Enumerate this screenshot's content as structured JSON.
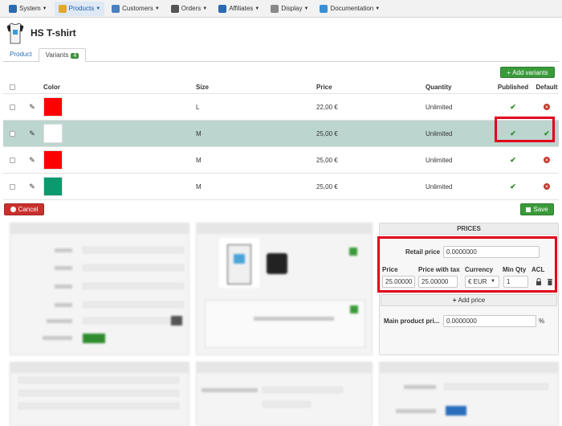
{
  "nav": {
    "items": [
      {
        "label": "System",
        "icon": "wrench-icon",
        "color": "#2b6cb0"
      },
      {
        "label": "Products",
        "icon": "box-icon",
        "color": "#e0a82e",
        "active": true
      },
      {
        "label": "Customers",
        "icon": "users-icon",
        "color": "#4a7fc1"
      },
      {
        "label": "Orders",
        "icon": "cart-icon",
        "color": "#555555"
      },
      {
        "label": "Affiliates",
        "icon": "affiliate-icon",
        "color": "#2b6cb0"
      },
      {
        "label": "Display",
        "icon": "display-icon",
        "color": "#888888"
      },
      {
        "label": "Documentation",
        "icon": "globe-icon",
        "color": "#3a8fd6"
      }
    ]
  },
  "product": {
    "title": "HS T-shirt"
  },
  "tabs": {
    "product": "Product",
    "variants": "Variants",
    "variants_count": "4"
  },
  "buttons": {
    "add_variants": "Add variants",
    "cancel": "Cancel",
    "save": "Save",
    "add_price": "Add price"
  },
  "table": {
    "headers": {
      "color": "Color",
      "size": "Size",
      "price": "Price",
      "quantity": "Quantity",
      "published": "Published",
      "default": "Default"
    },
    "rows": [
      {
        "color": "#ff0000",
        "size": "L",
        "price": "22,00 €",
        "quantity": "Unlimited",
        "published": true,
        "default": false
      },
      {
        "color": "#ffffff",
        "size": "M",
        "price": "25,00 €",
        "quantity": "Unlimited",
        "published": true,
        "default": true
      },
      {
        "color": "#ff0000",
        "size": "M",
        "price": "25,00 €",
        "quantity": "Unlimited",
        "published": true,
        "default": false
      },
      {
        "color": "#0b9a6e",
        "size": "M",
        "price": "25,00 €",
        "quantity": "Unlimited",
        "published": true,
        "default": false
      }
    ]
  },
  "prices": {
    "title": "PRICES",
    "retail_label": "Retail price",
    "retail_value": "0.0000000",
    "headers": {
      "price": "Price",
      "price_tax": "Price with tax",
      "currency": "Currency",
      "min_qty": "Min Qty",
      "acl": "ACL"
    },
    "price_value": "25.00000",
    "price_tax_value": "25.00000",
    "currency_value": "€ EUR",
    "min_qty_value": "1",
    "main_label": "Main product pri...",
    "main_value": "0.0000000",
    "percent": "%"
  }
}
